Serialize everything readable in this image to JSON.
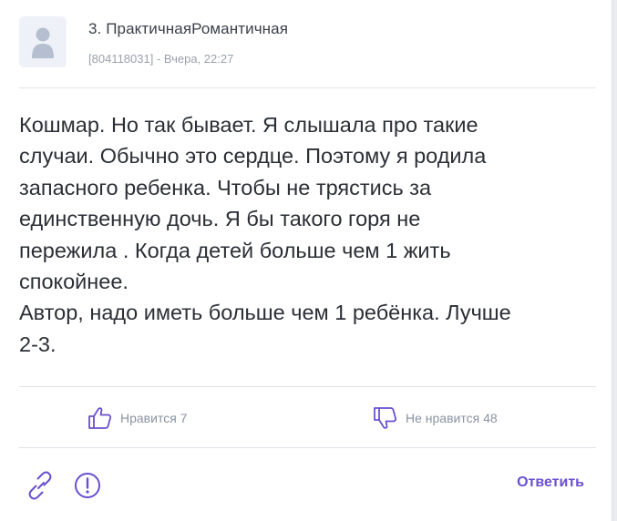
{
  "post": {
    "author": "3. ПрактичнаяРомантичная",
    "meta": "[804118031] - Вчера, 22:27",
    "text": "Кошмар. Но так бывает. Я слышала про такие\nслучаи. Обычно это сердце. Поэтому я родила\nзапасного ребенка. Чтобы не трястись за\nединственную дочь. Я бы такого горя не\nпережила . Когда детей больше чем 1 жить\nспокойнее.\nАвтор, надо иметь больше чем 1 ребёнка. Лучше\n2-3."
  },
  "reactions": {
    "like_label": "Нравится 7",
    "dislike_label": "Не нравится 48"
  },
  "footer": {
    "reply_label": "Ответить"
  },
  "icons": {
    "avatar": "user-silhouette-icon",
    "like": "thumbs-up-icon",
    "dislike": "thumbs-down-icon",
    "link": "link-icon",
    "report": "exclamation-circle-icon"
  },
  "colors": {
    "accent": "#6a4fcf",
    "muted": "#8a93a2",
    "text": "#2b2f36"
  }
}
